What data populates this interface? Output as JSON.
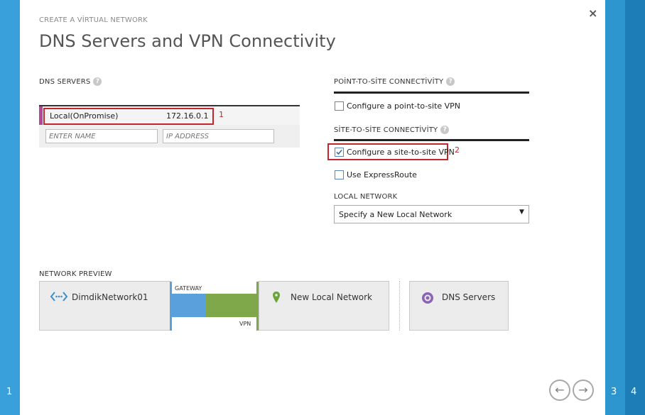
{
  "wizard": {
    "title": "CREATE A VİRTUAL NETWORK",
    "page_title": "DNS Servers and VPN Connectivity",
    "close_glyph": "×",
    "steps": [
      "1",
      "3",
      "4"
    ]
  },
  "dns": {
    "label": "DNS SERVERS",
    "entry": {
      "name": "Local(OnPromise)",
      "ip": "172.16.0.1"
    },
    "name_placeholder": "ENTER NAME",
    "ip_placeholder": "IP ADDRESS",
    "annotation": "1"
  },
  "p2s": {
    "label": "POİNT-TO-SİTE CONNECTİVİTY",
    "checkbox_label": "Configure a point-to-site VPN",
    "checked": false
  },
  "s2s": {
    "label": "SİTE-TO-SİTE CONNECTİVİTY",
    "checkbox_label": "Configure a site-to-site VPN",
    "checked": true,
    "annotation": "2",
    "express_label": "Use ExpressRoute",
    "express_checked": false
  },
  "local_network": {
    "label": "LOCAL NETWORK",
    "selected": "Specify a New Local Network"
  },
  "preview": {
    "label": "NETWORK PREVIEW",
    "vnet_name": "DimdikNetwork01",
    "gateway_label": "GATEWAY",
    "vpn_label": "VPN",
    "local_name": "New Local Network",
    "dns_name": "DNS Servers"
  },
  "nav": {
    "prev": "←",
    "next": "→"
  },
  "colors": {
    "accent": "#3aa0dc",
    "annotation": "#c4262e",
    "gateway": "#5aa0dc",
    "vpn": "#7ea84a",
    "dns_marker": "#b4479c"
  }
}
